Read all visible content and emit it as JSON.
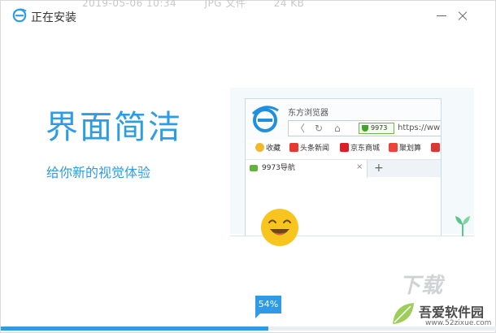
{
  "background_text": [
    "2019-05-06 10:34",
    "JPG 文件",
    "24 KB"
  ],
  "window": {
    "title": "正在安装",
    "logo_icon": "ie-style-e-icon",
    "minimize_icon": "minimize-icon",
    "close_icon": "close-icon"
  },
  "main": {
    "headline": "界面简洁",
    "subline": "给你新的视觉体验"
  },
  "preview": {
    "browser_name": "东方浏览器",
    "security_badge": "9973",
    "url_text": "https://www",
    "bookmarks": [
      {
        "label": "收藏",
        "icon": "star-icon"
      },
      {
        "label": "头条新闻",
        "icon": "news-icon"
      },
      {
        "label": "京东商城",
        "icon": "jd-icon"
      },
      {
        "label": "聚划算",
        "icon": "juhuasuan-icon"
      }
    ],
    "tab_label": "9973导航",
    "tab_close": "×",
    "new_tab": "+"
  },
  "progress": {
    "percent_label": "54%",
    "value": 0.54
  },
  "watermark": {
    "text": "吾爱软件园",
    "url": "www.52zixue.com",
    "big_text": "下载"
  },
  "colors": {
    "accent": "#2d9ce8",
    "progress": "#2f9ae6",
    "smiley": "#f7c51e"
  }
}
